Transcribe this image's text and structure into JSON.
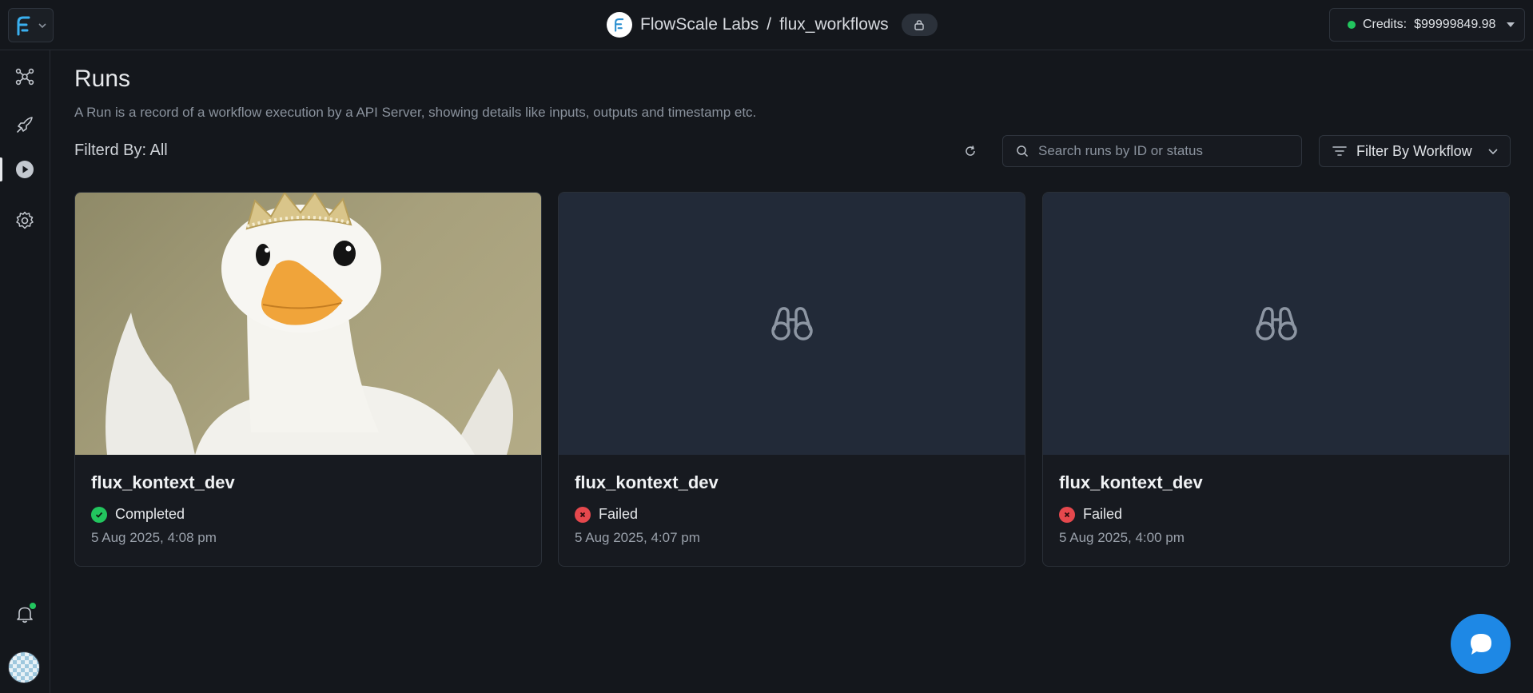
{
  "topbar": {
    "org_name": "FlowScale Labs",
    "separator": "/",
    "project_name": "flux_workflows",
    "credits_label": "Credits:",
    "credits_value": "$99999849.98"
  },
  "sidebar": {
    "items": [
      {
        "icon": "workflow-nodes-icon"
      },
      {
        "icon": "rocket-icon"
      },
      {
        "icon": "play-circle-icon",
        "active": true
      },
      {
        "icon": "gear-icon"
      }
    ]
  },
  "page": {
    "title": "Runs",
    "description": "A Run is a record of a workflow execution by a API Server, showing details like inputs, outputs and timestamp etc.",
    "filter_label": "Filterd By: All",
    "search_placeholder": "Search runs by ID or status",
    "filter_button": "Filter By Workflow"
  },
  "runs": [
    {
      "title": "flux_kontext_dev",
      "status": "Completed",
      "time": "5 Aug 2025, 4:08 pm",
      "has_image": true
    },
    {
      "title": "flux_kontext_dev",
      "status": "Failed",
      "time": "5 Aug 2025, 4:07 pm",
      "has_image": false
    },
    {
      "title": "flux_kontext_dev",
      "status": "Failed",
      "time": "5 Aug 2025, 4:00 pm",
      "has_image": false
    }
  ],
  "colors": {
    "completed": "#22c55e",
    "failed": "#e5484d",
    "accent": "#1e88e5"
  }
}
